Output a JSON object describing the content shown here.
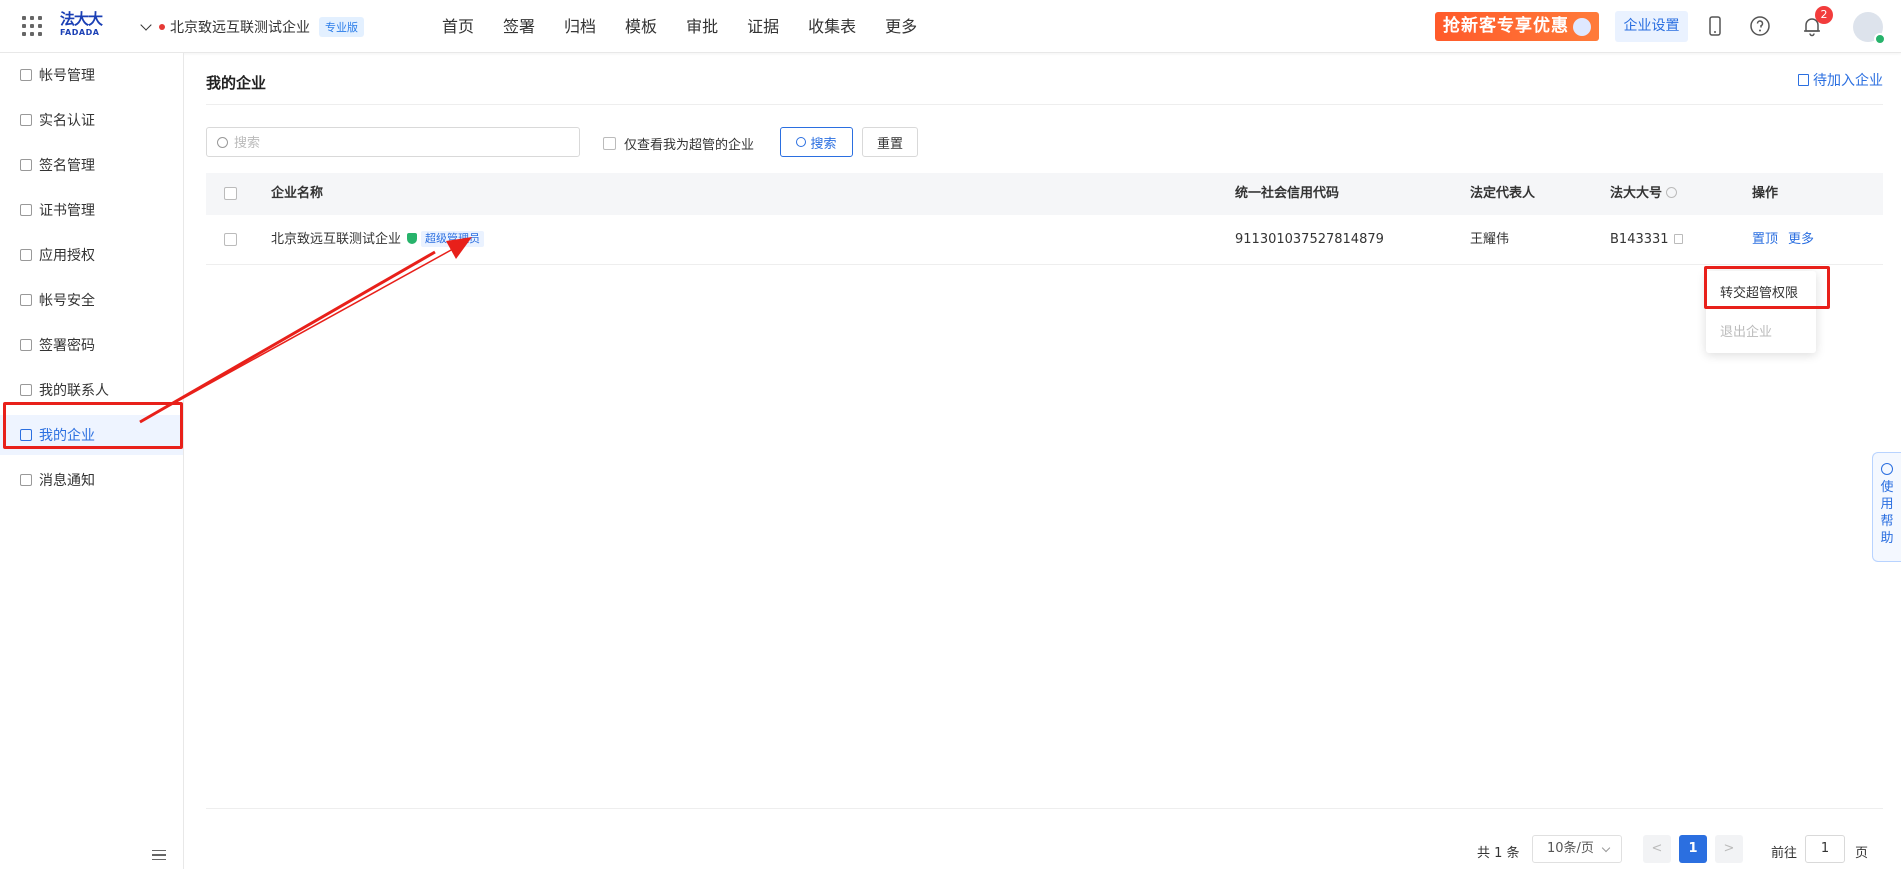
{
  "topbar": {
    "logo_cn": "法大大",
    "logo_en": "FADADA",
    "org_name": "北京致远互联测试企业",
    "edition": "专业版",
    "nav": [
      "首页",
      "签署",
      "归档",
      "模板",
      "审批",
      "证据",
      "收集表",
      "更多"
    ],
    "promo": "抢新客专享优惠",
    "org_settings": "企业设置",
    "notification_count": "2"
  },
  "sidebar": {
    "items": [
      {
        "label": "帐号管理",
        "icon": "account-icon"
      },
      {
        "label": "实名认证",
        "icon": "certification-icon"
      },
      {
        "label": "签名管理",
        "icon": "pen-icon"
      },
      {
        "label": "证书管理",
        "icon": "certificate-icon"
      },
      {
        "label": "应用授权",
        "icon": "apps-icon"
      },
      {
        "label": "帐号安全",
        "icon": "shield-icon"
      },
      {
        "label": "签署密码",
        "icon": "lock-icon"
      },
      {
        "label": "我的联系人",
        "icon": "contact-icon"
      },
      {
        "label": "我的企业",
        "icon": "building-icon",
        "active": true
      },
      {
        "label": "消息通知",
        "icon": "message-icon"
      }
    ]
  },
  "main": {
    "title": "我的企业",
    "pending_link": "待加入企业",
    "search_placeholder": "搜索",
    "only_super_label": "仅查看我为超管的企业",
    "search_button": "搜索",
    "reset_button": "重置",
    "columns": [
      "企业名称",
      "统一社会信用代码",
      "法定代表人",
      "法大大号",
      "操作"
    ],
    "rows": [
      {
        "name": "北京致远互联测试企业",
        "role_tag": "超级管理员",
        "credit_code": "911301037527814879",
        "legal_rep": "王耀伟",
        "fadada_no": "B143331",
        "action_pin": "置顶",
        "action_more": "更多"
      }
    ],
    "dropdown": [
      "转交超管权限",
      "退出企业"
    ]
  },
  "pager": {
    "total": "共 1 条",
    "page_size": "10条/页",
    "prev": "<",
    "current": "1",
    "next": ">",
    "goto_label": "前往",
    "goto_value": "1",
    "page_suffix": "页"
  },
  "help_tab": [
    "使",
    "用",
    "帮",
    "助"
  ],
  "colors": {
    "accent": "#2b6fe0",
    "highlight_box": "#e8201a",
    "promo": "#ff5a2a",
    "verified": "#27b36b"
  }
}
